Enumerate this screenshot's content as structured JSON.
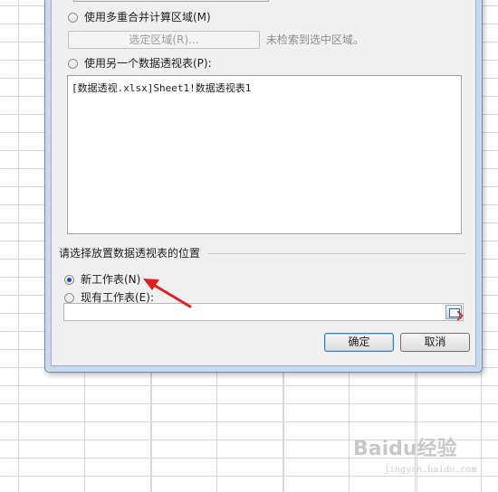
{
  "dialog": {
    "multi_consolidation_label": "使用多重合并计算区域(M)",
    "select_region_button": "选定区域(R)...",
    "no_region_status": "未检索到选中区域。",
    "another_pivot_label": "使用另一个数据透视表(P):",
    "pivot_list_item": "[数据透视.xlsx]Sheet1!数据透视表1",
    "placement_group_title": "请选择放置数据透视表的位置",
    "new_sheet_label": "新工作表(N)",
    "existing_sheet_label": "现有工作表(E):",
    "existing_sheet_value": "",
    "ok_button": "确定",
    "cancel_button": "取消",
    "selected_placement": "new_sheet"
  },
  "watermark": {
    "text": "Baidu经验",
    "url": "jingyan.baidu.com"
  },
  "colors": {
    "annotation_arrow": "#e02020",
    "frame": "#c9d9ec",
    "radio_dot": "#1c4f9c"
  }
}
